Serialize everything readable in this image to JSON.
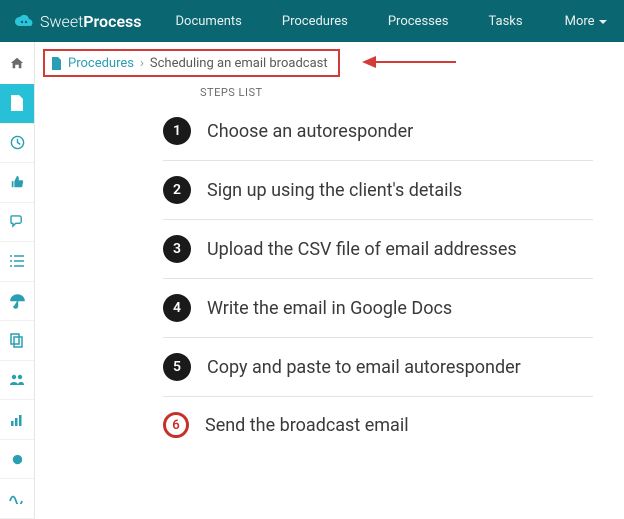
{
  "brand": {
    "light": "Sweet",
    "bold": "Process"
  },
  "nav": {
    "items": [
      "Documents",
      "Procedures",
      "Processes",
      "Tasks"
    ],
    "more": "More"
  },
  "breadcrumb": {
    "link": "Procedures",
    "current": "Scheduling an email broadcast"
  },
  "stepsHeader": "STEPS LIST",
  "steps": [
    {
      "n": "1",
      "title": "Choose an autoresponder",
      "hollow": false
    },
    {
      "n": "2",
      "title": "Sign up using the client's details",
      "hollow": false
    },
    {
      "n": "3",
      "title": "Upload the CSV file of email addresses",
      "hollow": false
    },
    {
      "n": "4",
      "title": "Write the email in Google Docs",
      "hollow": false
    },
    {
      "n": "5",
      "title": "Copy and paste to email autoresponder",
      "hollow": false
    },
    {
      "n": "6",
      "title": "Send the broadcast email",
      "hollow": true
    }
  ],
  "sidebarIcons": [
    "file-icon",
    "clock-icon",
    "thumb-icon",
    "chat-icon",
    "list-icon",
    "umbrella-icon",
    "copy-icon",
    "users-icon",
    "bars-icon",
    "gear-icon",
    "wave-icon"
  ]
}
